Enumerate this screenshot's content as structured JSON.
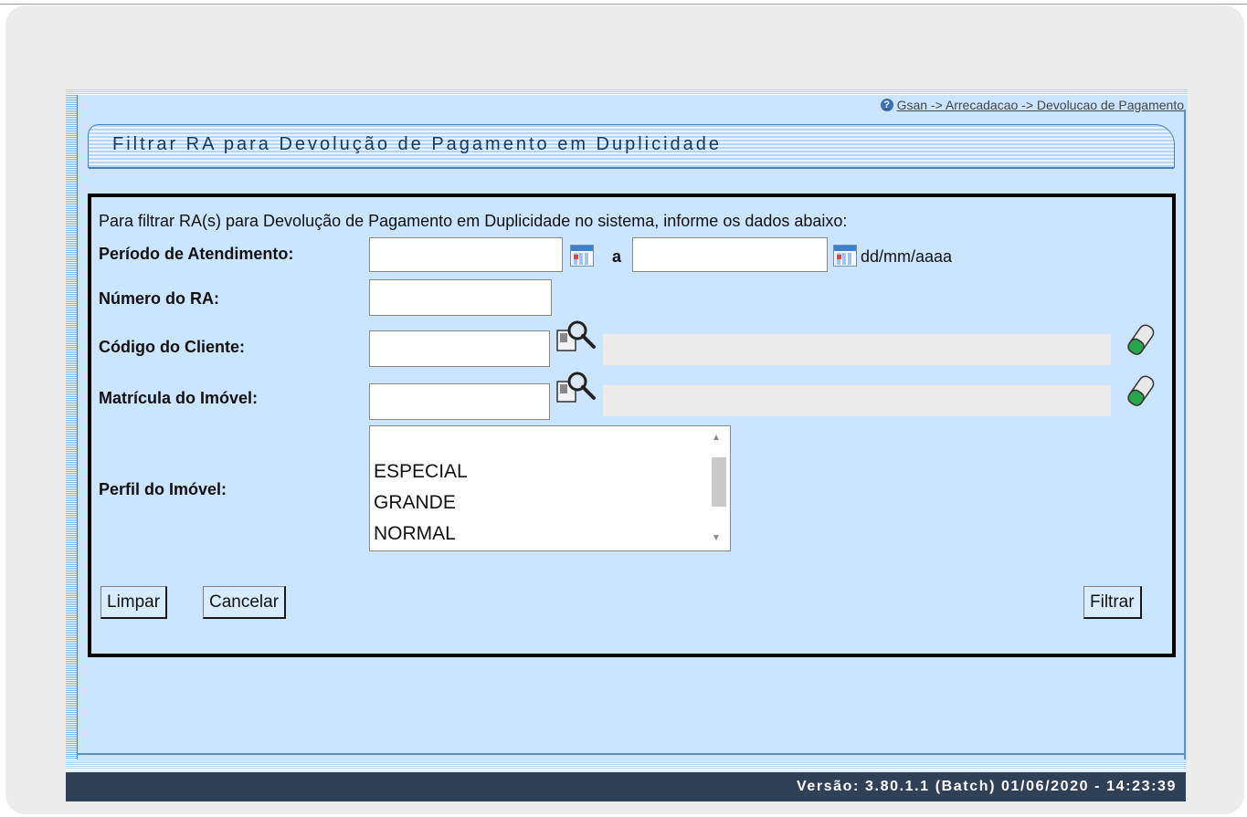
{
  "breadcrumb": "Gsan -> Arrecadacao -> Devolucao de Pagamento",
  "page_title": "Filtrar RA para Devolução de Pagamento em Duplicidade",
  "instructions": "Para filtrar RA(s) para Devolução de Pagamento em Duplicidade no sistema, informe os dados abaixo:",
  "form": {
    "periodo_label": "Período de Atendimento:",
    "periodo_inicio": "",
    "periodo_separator": "a",
    "periodo_fim": "",
    "date_format_hint": "dd/mm/aaaa",
    "numero_ra_label": "Número do RA:",
    "numero_ra": "",
    "codigo_cliente_label": "Código do Cliente:",
    "codigo_cliente": "",
    "cliente_nome": "",
    "matricula_label": "Matrícula do Imóvel:",
    "matricula": "",
    "imovel_descricao": "",
    "perfil_label": "Perfil do Imóvel:",
    "perfil_options": [
      "",
      "ESPECIAL",
      "GRANDE",
      "NORMAL"
    ]
  },
  "buttons": {
    "limpar": "Limpar",
    "cancelar": "Cancelar",
    "filtrar": "Filtrar"
  },
  "footer": {
    "version": "Versão: 3.80.1.1 (Batch) 01/06/2020 - 14:23:39"
  },
  "icons": {
    "help": "help-icon",
    "calendar": "calendar-icon",
    "search": "magnifier-icon",
    "clear": "eraser-icon"
  }
}
